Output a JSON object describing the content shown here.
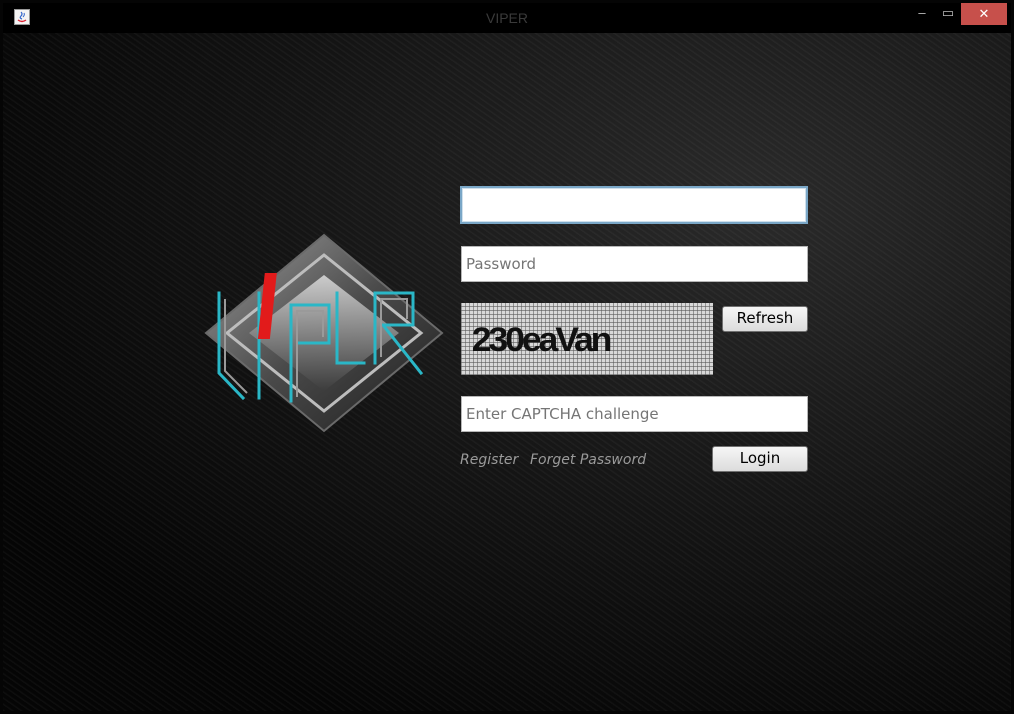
{
  "window": {
    "title": "VIPER",
    "minimize_label": "‒",
    "maximize_label": "▭",
    "close_label": "✕"
  },
  "logo": {
    "text": "VIPER",
    "accent_color": "#e21b1b",
    "glow_color": "#2ab7c7"
  },
  "form": {
    "username": {
      "value": "",
      "placeholder": ""
    },
    "password": {
      "value": "",
      "placeholder": "Password"
    },
    "captcha": {
      "image_text": "230eaVan",
      "refresh_label": "Refresh"
    },
    "captcha_input": {
      "value": "",
      "placeholder": "Enter CAPTCHA challenge"
    },
    "register_label": "Register",
    "forget_label": "Forget Password",
    "login_label": "Login"
  },
  "colors": {
    "close_button": "#c7504b",
    "focus_border": "#7aa7c7"
  }
}
